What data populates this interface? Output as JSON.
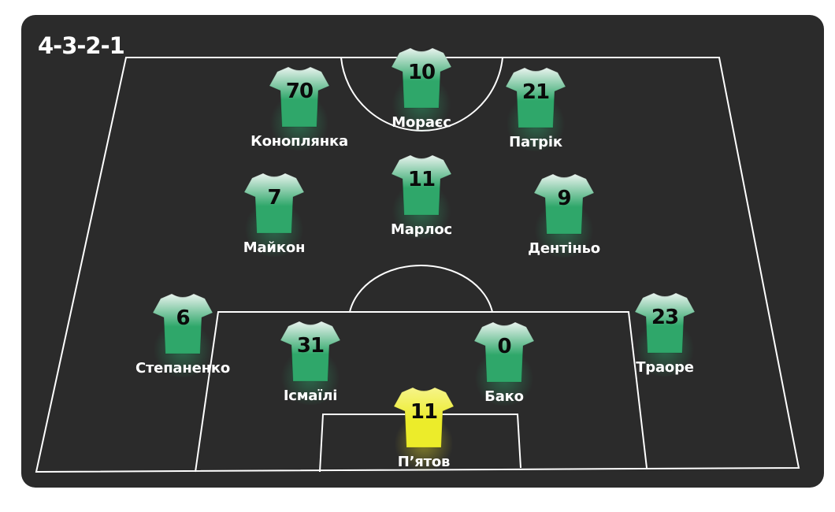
{
  "formation": "4-3-2-1",
  "colors": {
    "background": "#2b2b2b",
    "lines": "#ffffff",
    "outfield_shirt": "#2fa76a",
    "goalkeeper_shirt": "#ecec2a"
  },
  "players": [
    {
      "number": "70",
      "name": "Коноплянка",
      "role": "outfield"
    },
    {
      "number": "10",
      "name": "Мораєс",
      "role": "outfield"
    },
    {
      "number": "21",
      "name": "Патрік",
      "role": "outfield"
    },
    {
      "number": "7",
      "name": "Майкон",
      "role": "outfield"
    },
    {
      "number": "11",
      "name": "Марлос",
      "role": "outfield"
    },
    {
      "number": "9",
      "name": "Дентіньо",
      "role": "outfield"
    },
    {
      "number": "6",
      "name": "Степаненко",
      "role": "outfield"
    },
    {
      "number": "23",
      "name": "Траоре",
      "role": "outfield"
    },
    {
      "number": "31",
      "name": "Ісмаїлі",
      "role": "outfield"
    },
    {
      "number": "0",
      "name": "Бако",
      "role": "outfield"
    },
    {
      "number": "11",
      "name": "П’ятов",
      "role": "goalkeeper"
    }
  ]
}
